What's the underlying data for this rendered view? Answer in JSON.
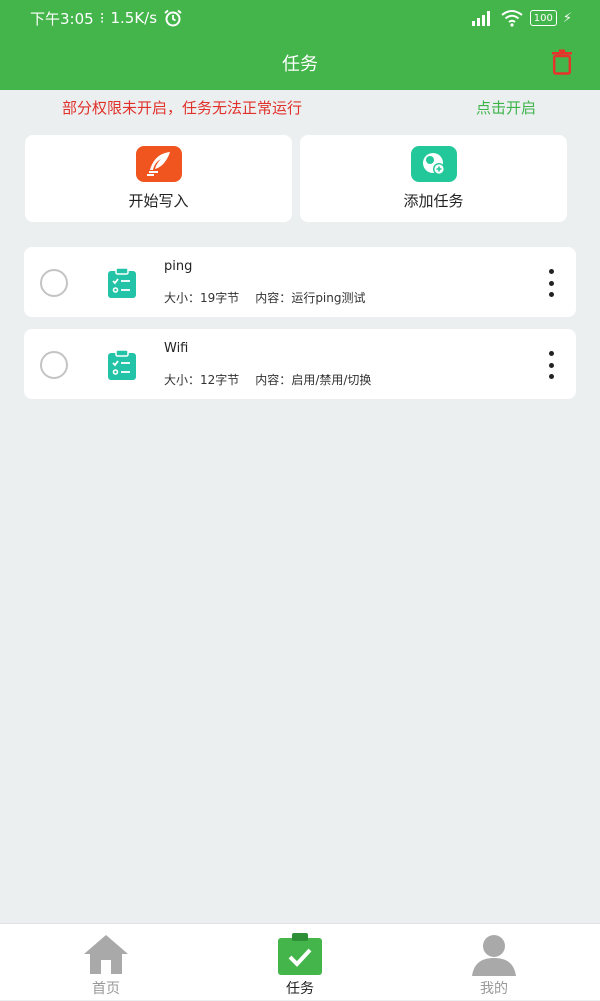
{
  "statusbar": {
    "time": "下午3:05",
    "speed": "1.5K/s",
    "battery": "100"
  },
  "appbar": {
    "title": "任务"
  },
  "permission": {
    "warning": "部分权限未开启，任务无法正常运行",
    "action": "点击开启"
  },
  "actions": [
    {
      "label": "开始写入",
      "icon": "quill-icon",
      "color": "#f0541f"
    },
    {
      "label": "添加任务",
      "icon": "add-task-icon",
      "color": "#22c79a"
    }
  ],
  "tasks": [
    {
      "name": "ping",
      "size_label": "大小：",
      "size": "19字节",
      "content_label": "内容：",
      "content": "运行ping测试"
    },
    {
      "name": "Wifi",
      "size_label": "大小：",
      "size": "12字节",
      "content_label": "内容：",
      "content": "启用/禁用/切换"
    }
  ],
  "nav": [
    {
      "label": "首页",
      "icon": "home-icon"
    },
    {
      "label": "任务",
      "icon": "task-clipboard-icon",
      "active": true
    },
    {
      "label": "我的",
      "icon": "user-icon"
    }
  ],
  "colors": {
    "primary": "#43b54a",
    "warning": "#e0312b",
    "teal": "#22c3a6"
  }
}
